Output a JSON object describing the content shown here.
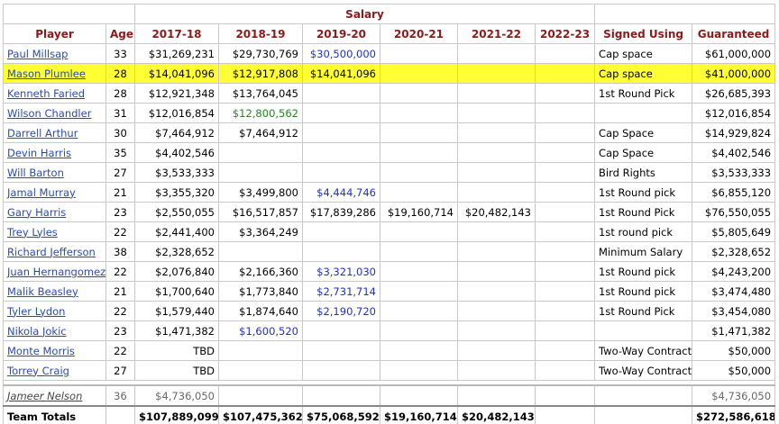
{
  "header": {
    "salary_group": "Salary",
    "columns": [
      "Player",
      "Age",
      "2017-18",
      "2018-19",
      "2019-20",
      "2020-21",
      "2021-22",
      "2022-23",
      "Signed Using",
      "Guaranteed"
    ]
  },
  "rows": [
    {
      "player": "Paul Millsap",
      "age": "33",
      "y1718": "$31,269,231",
      "y1819": "$29,730,769",
      "y1920": "$30,500,000",
      "y2021": "",
      "y2122": "",
      "y2223": "",
      "signed": "Cap space",
      "guaranteed": "$61,000,000",
      "y1920_color": "blue",
      "highlight": false
    },
    {
      "player": "Mason Plumlee",
      "age": "28",
      "y1718": "$14,041,096",
      "y1819": "$12,917,808",
      "y1920": "$14,041,096",
      "y2021": "",
      "y2122": "",
      "y2223": "",
      "signed": "Cap space",
      "guaranteed": "$41,000,000",
      "highlight": true
    },
    {
      "player": "Kenneth Faried",
      "age": "28",
      "y1718": "$12,921,348",
      "y1819": "$13,764,045",
      "y1920": "",
      "y2021": "",
      "y2122": "",
      "y2223": "",
      "signed": "1st Round Pick",
      "guaranteed": "$26,685,393",
      "highlight": false
    },
    {
      "player": "Wilson Chandler",
      "age": "31",
      "y1718": "$12,016,854",
      "y1819": "$12,800,562",
      "y1920": "",
      "y2021": "",
      "y2122": "",
      "y2223": "",
      "signed": "",
      "guaranteed": "$12,016,854",
      "y1819_color": "green",
      "highlight": false
    },
    {
      "player": "Darrell Arthur",
      "age": "30",
      "y1718": "$7,464,912",
      "y1819": "$7,464,912",
      "y1920": "",
      "y2021": "",
      "y2122": "",
      "y2223": "",
      "signed": "Cap Space",
      "guaranteed": "$14,929,824",
      "highlight": false
    },
    {
      "player": "Devin Harris",
      "age": "35",
      "y1718": "$4,402,546",
      "y1819": "",
      "y1920": "",
      "y2021": "",
      "y2122": "",
      "y2223": "",
      "signed": "Cap Space",
      "guaranteed": "$4,402,546",
      "highlight": false
    },
    {
      "player": "Will Barton",
      "age": "27",
      "y1718": "$3,533,333",
      "y1819": "",
      "y1920": "",
      "y2021": "",
      "y2122": "",
      "y2223": "",
      "signed": "Bird Rights",
      "guaranteed": "$3,533,333",
      "highlight": false
    },
    {
      "player": "Jamal Murray",
      "age": "21",
      "y1718": "$3,355,320",
      "y1819": "$3,499,800",
      "y1920": "$4,444,746",
      "y2021": "",
      "y2122": "",
      "y2223": "",
      "signed": "1st Round pick",
      "guaranteed": "$6,855,120",
      "y1920_color": "blue",
      "highlight": false
    },
    {
      "player": "Gary Harris",
      "age": "23",
      "y1718": "$2,550,055",
      "y1819": "$16,517,857",
      "y1920": "$17,839,286",
      "y2021": "$19,160,714",
      "y2122": "$20,482,143",
      "y2223": "",
      "signed": "1st Round Pick",
      "guaranteed": "$76,550,055",
      "highlight": false
    },
    {
      "player": "Trey Lyles",
      "age": "22",
      "y1718": "$2,441,400",
      "y1819": "$3,364,249",
      "y1920": "",
      "y2021": "",
      "y2122": "",
      "y2223": "",
      "signed": "1st round pick",
      "guaranteed": "$5,805,649",
      "highlight": false
    },
    {
      "player": "Richard Jefferson",
      "age": "38",
      "y1718": "$2,328,652",
      "y1819": "",
      "y1920": "",
      "y2021": "",
      "y2122": "",
      "y2223": "",
      "signed": "Minimum Salary",
      "guaranteed": "$2,328,652",
      "highlight": false
    },
    {
      "player": "Juan Hernangomez",
      "age": "22",
      "y1718": "$2,076,840",
      "y1819": "$2,166,360",
      "y1920": "$3,321,030",
      "y2021": "",
      "y2122": "",
      "y2223": "",
      "signed": "1st Round pick",
      "guaranteed": "$4,243,200",
      "y1920_color": "blue",
      "highlight": false
    },
    {
      "player": "Malik Beasley",
      "age": "21",
      "y1718": "$1,700,640",
      "y1819": "$1,773,840",
      "y1920": "$2,731,714",
      "y2021": "",
      "y2122": "",
      "y2223": "",
      "signed": "1st Round pick",
      "guaranteed": "$3,474,480",
      "y1920_color": "blue",
      "highlight": false
    },
    {
      "player": "Tyler Lydon",
      "age": "22",
      "y1718": "$1,579,440",
      "y1819": "$1,874,640",
      "y1920": "$2,190,720",
      "y2021": "",
      "y2122": "",
      "y2223": "",
      "signed": "1st Round Pick",
      "guaranteed": "$3,454,080",
      "y1920_color": "blue",
      "highlight": false
    },
    {
      "player": "Nikola Jokic",
      "age": "23",
      "y1718": "$1,471,382",
      "y1819": "$1,600,520",
      "y1920": "",
      "y2021": "",
      "y2122": "",
      "y2223": "",
      "signed": "",
      "guaranteed": "$1,471,382",
      "y1819_color": "blue",
      "highlight": false
    },
    {
      "player": "Monte Morris",
      "age": "22",
      "y1718": "TBD",
      "y1819": "",
      "y1920": "",
      "y2021": "",
      "y2122": "",
      "y2223": "",
      "signed": "Two-Way Contract",
      "guaranteed": "$50,000",
      "highlight": false
    },
    {
      "player": "Torrey Craig",
      "age": "27",
      "y1718": "TBD",
      "y1819": "",
      "y1920": "",
      "y2021": "",
      "y2122": "",
      "y2223": "",
      "signed": "Two-Way Contract",
      "guaranteed": "$50,000",
      "highlight": false
    }
  ],
  "dead_money": {
    "player": "Jameer Nelson",
    "age": "36",
    "y1718": "$4,736,050",
    "guaranteed": "$4,736,050"
  },
  "totals": {
    "label": "Team Totals",
    "y1718": "$107,889,099",
    "y1819": "$107,475,362",
    "y1920": "$75,068,592",
    "y2021": "$19,160,714",
    "y2122": "$20,482,143",
    "y2223": "",
    "guaranteed": "$272,586,618"
  },
  "colors": {
    "header_text": "#8b1a1a",
    "link": "#2a4ab3",
    "highlight": "#ffff33",
    "blue_value": "#1f2fd0",
    "green_value": "#1a8a1a"
  }
}
